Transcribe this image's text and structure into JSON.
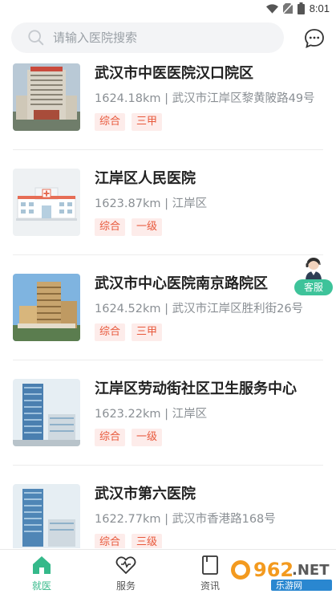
{
  "status_bar": {
    "time": "8:01"
  },
  "search": {
    "placeholder": "请输入医院搜索",
    "value": ""
  },
  "hospitals": [
    {
      "name": "武汉市中医医院汉口院区",
      "distance": "1624.18km",
      "address": "武汉市江岸区黎黄陂路49号",
      "tags": [
        "综合",
        "三甲"
      ],
      "image": "hospital-building-photo"
    },
    {
      "name": "江岸区人民医院",
      "distance": "1623.87km",
      "address": "江岸区",
      "tags": [
        "综合",
        "一级"
      ],
      "image": "hospital-placeholder-illustration"
    },
    {
      "name": "武汉市中心医院南京路院区",
      "distance": "1624.52km",
      "address": "武汉市江岸区胜利街26号",
      "tags": [
        "综合",
        "三甲"
      ],
      "image": "hospital-building-photo"
    },
    {
      "name": "江岸区劳动街社区卫生服务中心",
      "distance": "1623.22km",
      "address": "江岸区",
      "tags": [
        "综合",
        "一级"
      ],
      "image": "hospital-building-photo"
    },
    {
      "name": "武汉市第六医院",
      "distance": "1622.77km",
      "address": "武汉市香港路168号",
      "tags": [
        "综合",
        "三级"
      ],
      "image": "hospital-building-photo"
    }
  ],
  "customer_service": {
    "label": "客服",
    "icon": "headset-agent-icon"
  },
  "bottom_nav": [
    {
      "label": "就医",
      "icon": "home-icon",
      "active": true
    },
    {
      "label": "服务",
      "icon": "heart-icon",
      "active": false
    },
    {
      "label": "资讯",
      "icon": "document-icon",
      "active": false
    }
  ],
  "colors": {
    "accent": "#35b98a",
    "tag_text": "#e8593c",
    "tag_bg": "#fdecea"
  }
}
